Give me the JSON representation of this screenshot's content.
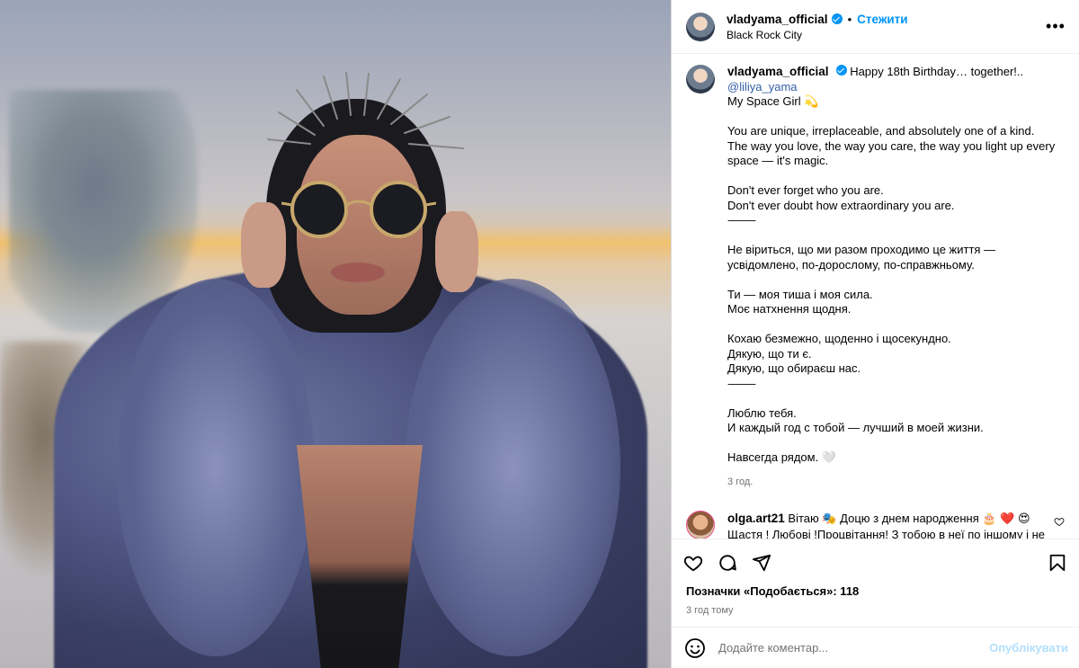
{
  "post": {
    "username": "vladyama_official",
    "follow_label": "Стежити",
    "dot": "•",
    "location": "Black Rock City",
    "more": "•••"
  },
  "caption": {
    "username": "vladyama_official",
    "first_line": "Happy 18th Birthday… together!..",
    "mention": "@liliya_yama",
    "lines": [
      "My Space Girl 💫",
      "",
      "You are unique, irreplaceable, and absolutely one of a kind.",
      "The way you love, the way you care, the way you light up every space — it's magic.",
      "",
      "Don't ever forget who you are.",
      "Don't ever doubt how extraordinary you are.",
      "⸻",
      "",
      "Не віриться, що ми разом проходимо це життя — усвідомлено, по-дорослому, по-справжньому.",
      "",
      "Ти — моя тиша і моя сила.",
      "Моє натхнення щодня.",
      "",
      "Кохаю безмежно, щоденно і щосекундно.",
      "Дякую, що ти є.",
      "Дякую, що обираєш нас.",
      "⸻",
      "",
      "Люблю тебя.",
      "И каждый год с тобой — лучший в моей жизни.",
      "",
      "Навсегда рядом. 🤍"
    ],
    "time": "3 год."
  },
  "comment": {
    "username": "olga.art21",
    "text": "Вітаю 🎭 Доцю з днем народження 🎂 ❤️ 😍 Щастя ! Любові !Процвітання! З тобою в неї по іншому і не може бути 💖 💪 ✌️ 🫶 ❤️",
    "like_icon": "heart-outline"
  },
  "actions": {
    "likes_label": "Позначки «Подобається»: 118",
    "ago": "3 год тому"
  },
  "add_comment": {
    "placeholder": "Додайте коментар...",
    "publish_label": "Опублікувати"
  },
  "colors": {
    "accent": "#0095f6",
    "publish_disabled": "#b2dffc",
    "muted": "#737373"
  }
}
